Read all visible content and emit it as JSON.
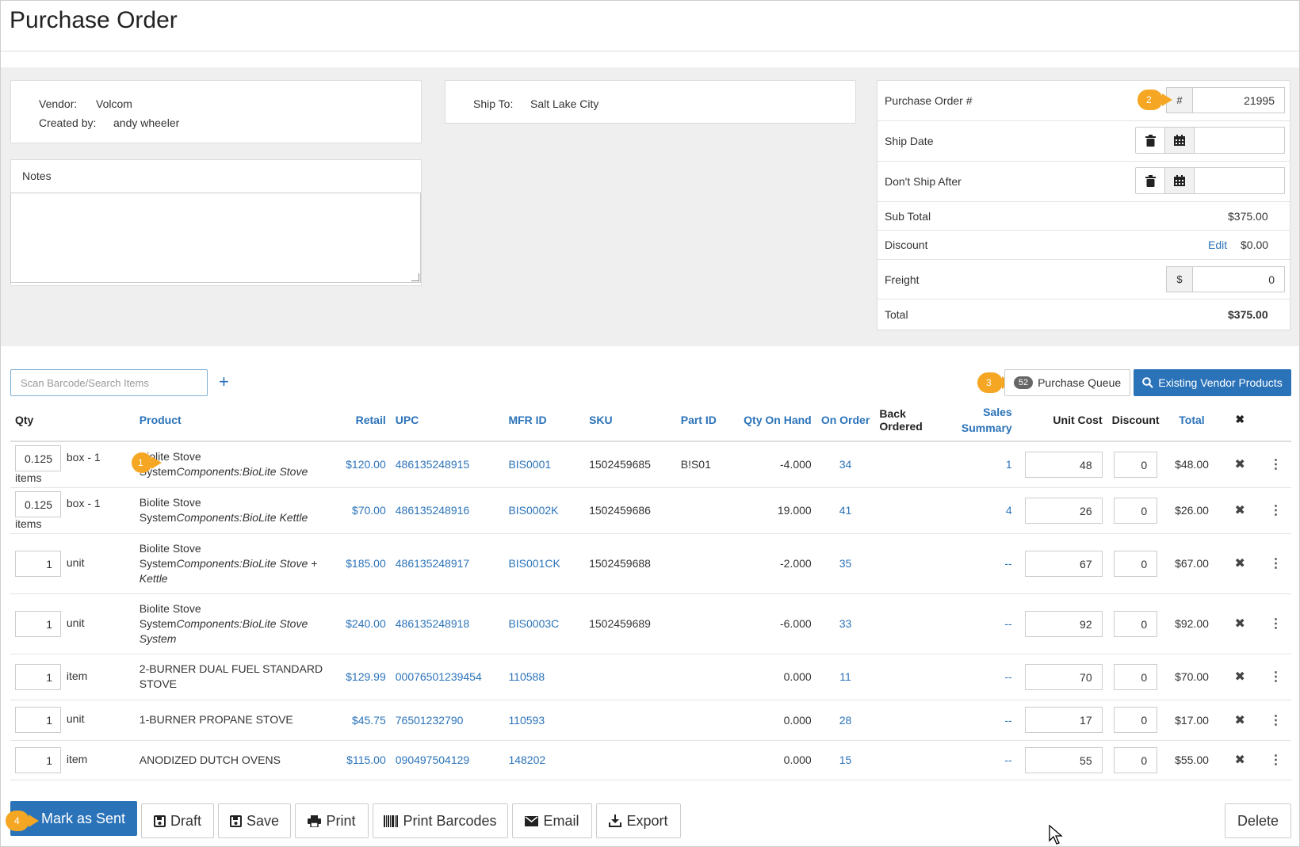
{
  "header": {
    "title": "Purchase Order"
  },
  "vendor_card": {
    "vendor_label": "Vendor:",
    "vendor_value": "Volcom",
    "created_label": "Created by:",
    "created_value": "andy wheeler"
  },
  "notes": {
    "label": "Notes",
    "value": ""
  },
  "ship_card": {
    "label": "Ship To:",
    "value": "Salt Lake City"
  },
  "po_panel": {
    "po_label": "Purchase Order #",
    "po_prefix": "#",
    "po_value": "21995",
    "ship_date_label": "Ship Date",
    "ship_date_value": "",
    "dont_ship_label": "Don't Ship After",
    "dont_ship_value": "",
    "subtotal_label": "Sub Total",
    "subtotal_value": "$375.00",
    "discount_label": "Discount",
    "discount_edit": "Edit",
    "discount_value": "$0.00",
    "freight_label": "Freight",
    "freight_prefix": "$",
    "freight_value": "0",
    "total_label": "Total",
    "total_value": "$375.00"
  },
  "callouts": {
    "c1": "1",
    "c2": "2",
    "c3": "3",
    "c4": "4"
  },
  "toolbar": {
    "search_placeholder": "Scan Barcode/Search Items",
    "add_label": "+",
    "queue_count": "52",
    "queue_label": "Purchase Queue",
    "existing_label": "Existing Vendor Products"
  },
  "table": {
    "columns": [
      "Qty",
      "Product",
      "Retail",
      "UPC",
      "MFR ID",
      "SKU",
      "Part ID",
      "Qty On Hand",
      "On Order",
      "Back Ordered",
      "Sales Summary",
      "Unit Cost",
      "Discount",
      "Total",
      "✖"
    ],
    "rows": [
      {
        "qty": "0.125",
        "unit": "box - 1 items",
        "product": "Biolite Stove",
        "product_path_prefix": "System",
        "product_path": "Components:BioLite Stove",
        "retail": "$120.00",
        "upc": "486135248915",
        "mfr": "BIS0001",
        "sku": "1502459685",
        "part": "B!S01",
        "on_hand": "-4.000",
        "on_order": "34",
        "back_ordered": "",
        "sales": "1",
        "unit_cost": "48",
        "discount": "0",
        "total": "$48.00"
      },
      {
        "qty": "0.125",
        "unit": "box - 1 items",
        "product": "Biolite Stove",
        "product_path_prefix": "System",
        "product_path": "Components:BioLite Kettle",
        "retail": "$70.00",
        "upc": "486135248916",
        "mfr": "BIS0002K",
        "sku": "1502459686",
        "part": "",
        "on_hand": "19.000",
        "on_order": "41",
        "back_ordered": "",
        "sales": "4",
        "unit_cost": "26",
        "discount": "0",
        "total": "$26.00"
      },
      {
        "qty": "1",
        "unit": "unit",
        "product": "Biolite Stove",
        "product_path_prefix": "System",
        "product_path": "Components:BioLite Stove + Kettle",
        "retail": "$185.00",
        "upc": "486135248917",
        "mfr": "BIS001CK",
        "sku": "1502459688",
        "part": "",
        "on_hand": "-2.000",
        "on_order": "35",
        "back_ordered": "",
        "sales": "--",
        "unit_cost": "67",
        "discount": "0",
        "total": "$67.00"
      },
      {
        "qty": "1",
        "unit": "unit",
        "product": "Biolite Stove",
        "product_path_prefix": "System",
        "product_path": "Components:BioLite Stove System",
        "retail": "$240.00",
        "upc": "486135248918",
        "mfr": "BIS0003C",
        "sku": "1502459689",
        "part": "",
        "on_hand": "-6.000",
        "on_order": "33",
        "back_ordered": "",
        "sales": "--",
        "unit_cost": "92",
        "discount": "0",
        "total": "$92.00"
      },
      {
        "qty": "1",
        "unit": "item",
        "product": "2-BURNER DUAL FUEL STANDARD STOVE",
        "product_path_prefix": "",
        "product_path": "",
        "retail": "$129.99",
        "upc": "00076501239454",
        "mfr": "110588",
        "sku": "",
        "part": "",
        "on_hand": "0.000",
        "on_order": "11",
        "back_ordered": "",
        "sales": "--",
        "unit_cost": "70",
        "discount": "0",
        "total": "$70.00"
      },
      {
        "qty": "1",
        "unit": "unit",
        "product": "1-BURNER PROPANE STOVE",
        "product_path_prefix": "",
        "product_path": "",
        "retail": "$45.75",
        "upc": "76501232790",
        "mfr": "110593",
        "sku": "",
        "part": "",
        "on_hand": "0.000",
        "on_order": "28",
        "back_ordered": "",
        "sales": "--",
        "unit_cost": "17",
        "discount": "0",
        "total": "$17.00"
      },
      {
        "qty": "1",
        "unit": "item",
        "product": "ANODIZED DUTCH OVENS",
        "product_path_prefix": "",
        "product_path": "",
        "retail": "$115.00",
        "upc": "090497504129",
        "mfr": "148202",
        "sku": "",
        "part": "",
        "on_hand": "0.000",
        "on_order": "15",
        "back_ordered": "",
        "sales": "--",
        "unit_cost": "55",
        "discount": "0",
        "total": "$55.00"
      }
    ]
  },
  "footer": {
    "mark_sent": "Mark as Sent",
    "draft": "Draft",
    "save": "Save",
    "print": "Print",
    "print_barcodes": "Print Barcodes",
    "email": "Email",
    "export": "Export",
    "delete": "Delete"
  },
  "colors": {
    "accent": "#2b73b9",
    "callout": "#f5a623",
    "panel_bg": "#efefef"
  }
}
